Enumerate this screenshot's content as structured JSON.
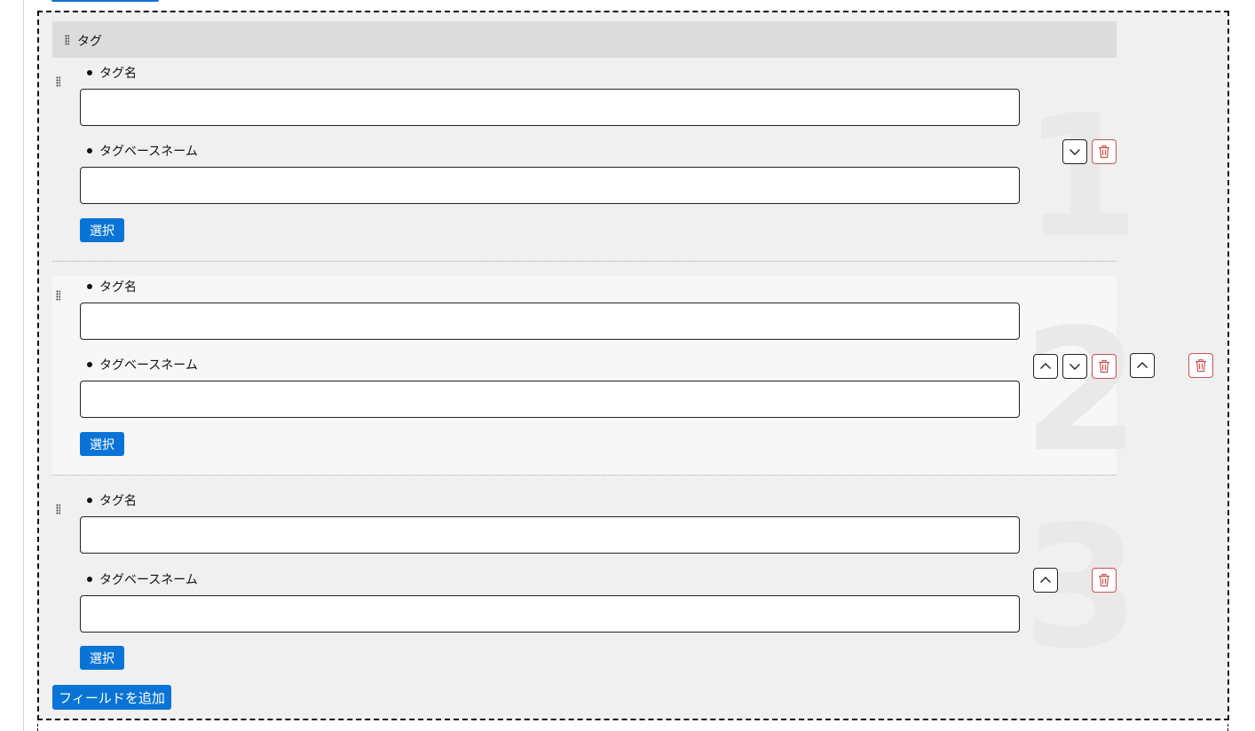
{
  "group": {
    "title": "タグ",
    "rows": [
      {
        "number": "1",
        "field1_label": "タグ名",
        "field1_value": "",
        "field2_label": "タグベースネーム",
        "field2_value": "",
        "select_label": "選択"
      },
      {
        "number": "2",
        "field1_label": "タグ名",
        "field1_value": "",
        "field2_label": "タグベースネーム",
        "field2_value": "",
        "select_label": "選択"
      },
      {
        "number": "3",
        "field1_label": "タグ名",
        "field1_value": "",
        "field2_label": "タグベースネーム",
        "field2_value": "",
        "select_label": "選択"
      }
    ],
    "add_field_label": "フィールドを追加"
  },
  "icons": {
    "drag": "drag-handle-icon",
    "up": "chevron-up-icon",
    "down": "chevron-down-icon",
    "delete": "trash-icon"
  },
  "colors": {
    "accent": "#0a74d6",
    "delete": "#d05050",
    "group_bg": "#f0f0f0",
    "header_bg": "#dcdcdc",
    "row_alt_bg": "#f7f7f7"
  }
}
